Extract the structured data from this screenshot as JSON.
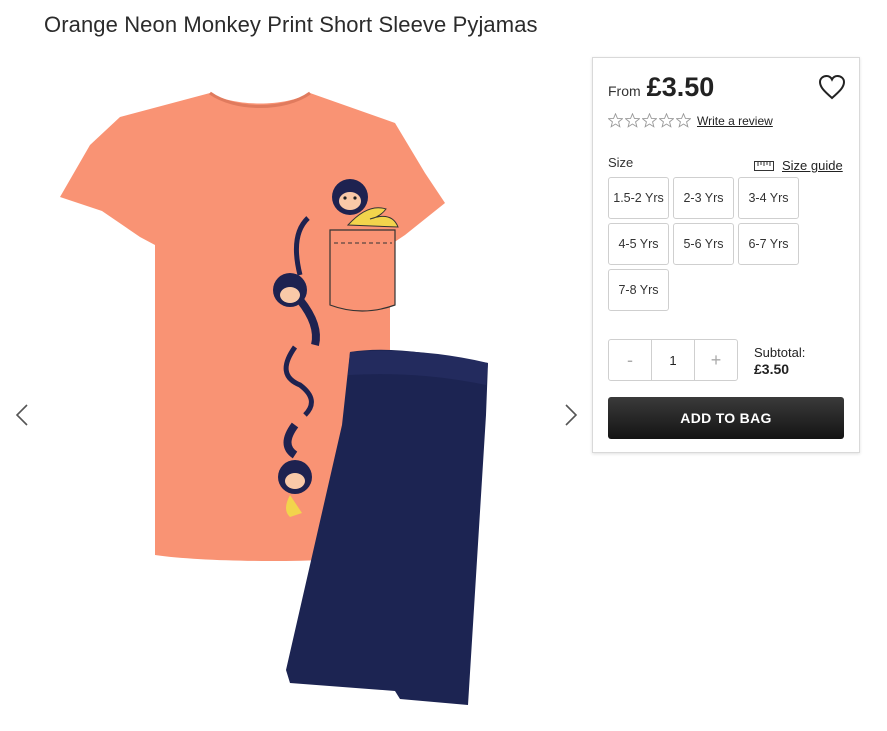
{
  "product": {
    "title": "Orange Neon Monkey Print Short Sleeve Pyjamas"
  },
  "gallery": {
    "prev_icon": "chevron-left-icon",
    "next_icon": "chevron-right-icon"
  },
  "pricing": {
    "prefix": "From",
    "price": "£3.50"
  },
  "rating": {
    "stars_filled": 0,
    "stars_total": 5,
    "review_link": "Write a review"
  },
  "sizes": {
    "label": "Size",
    "guide_label": "Size guide",
    "options": [
      "1.5-2 Yrs",
      "2-3 Yrs",
      "3-4 Yrs",
      "4-5 Yrs",
      "5-6 Yrs",
      "6-7 Yrs",
      "7-8 Yrs"
    ]
  },
  "quantity": {
    "decrement": "-",
    "value": "1",
    "increment": "+"
  },
  "subtotal": {
    "label": "Subtotal:",
    "value": "£3.50"
  },
  "actions": {
    "add_to_bag": "ADD TO BAG"
  },
  "colors": {
    "tshirt": "#F99374",
    "shorts": "#1C2452",
    "button": "#1f1f1f"
  }
}
